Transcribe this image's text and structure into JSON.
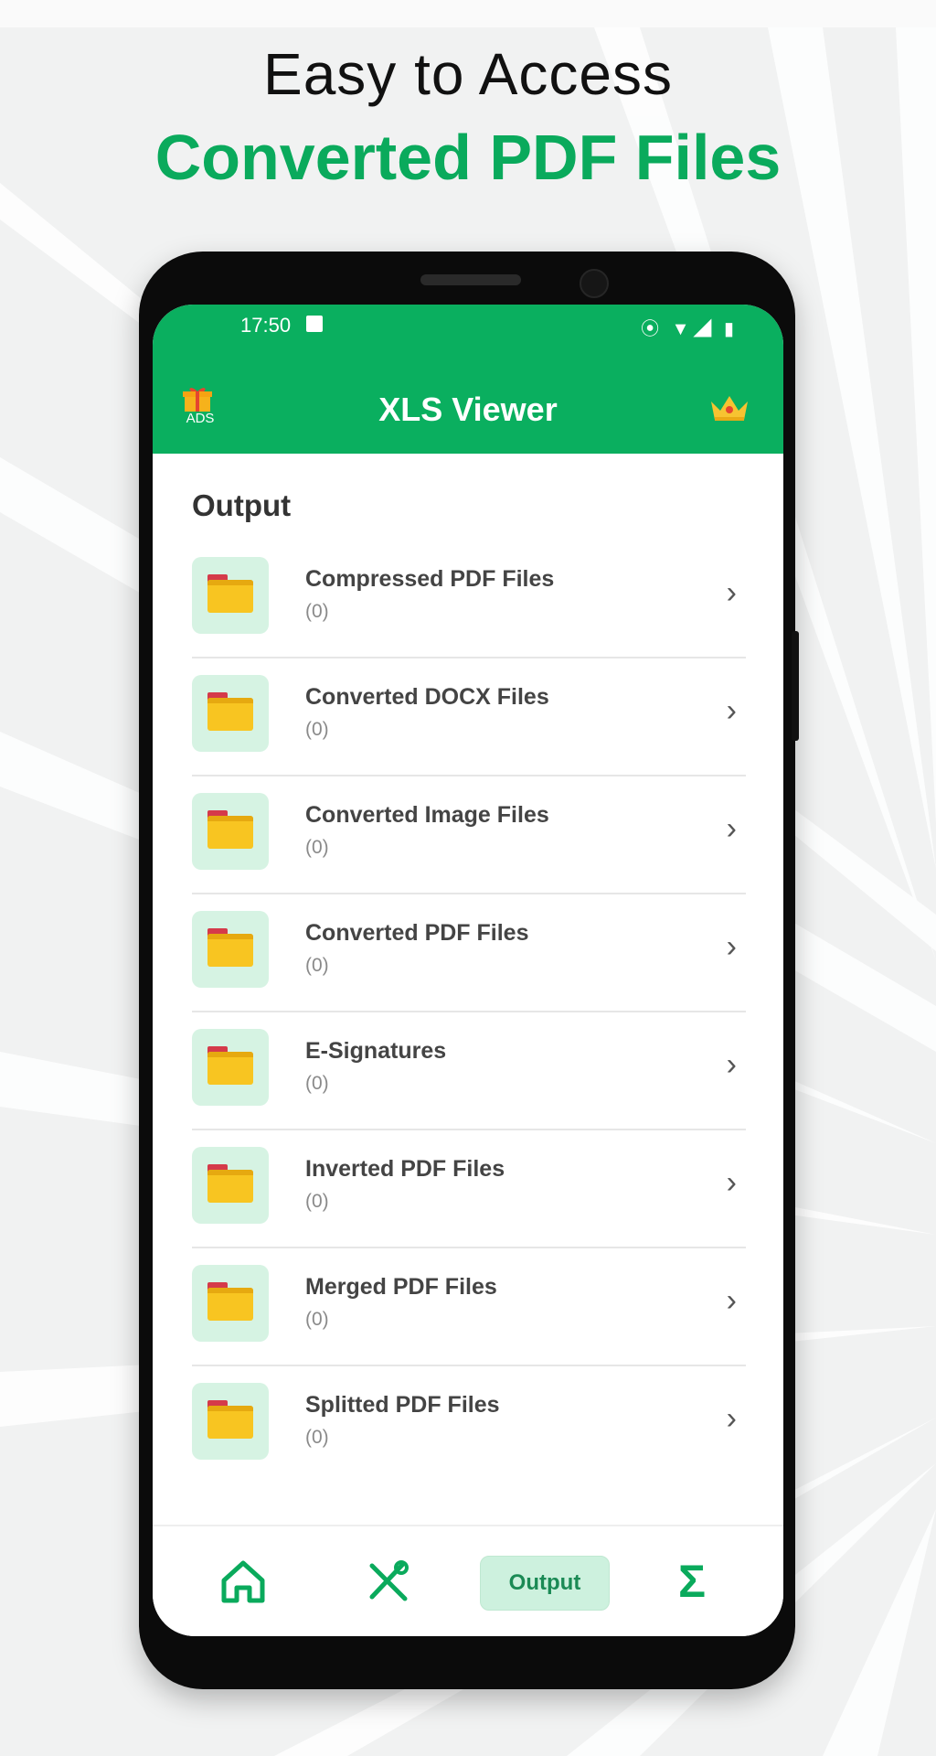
{
  "hero": {
    "line1": "Easy to Access",
    "line2": "Converted PDF Files"
  },
  "status_bar": {
    "time": "17:50",
    "icons": "⦿ ▼◢ ▮"
  },
  "app_bar": {
    "ads_label": "ADS",
    "title": "XLS Viewer"
  },
  "section_title": "Output",
  "items": [
    {
      "label": "Compressed PDF Files",
      "count": "(0)"
    },
    {
      "label": "Converted DOCX Files",
      "count": "(0)"
    },
    {
      "label": "Converted Image Files",
      "count": "(0)"
    },
    {
      "label": "Converted PDF Files",
      "count": "(0)"
    },
    {
      "label": "E-Signatures",
      "count": "(0)"
    },
    {
      "label": "Inverted PDF Files",
      "count": "(0)"
    },
    {
      "label": "Merged PDF Files",
      "count": "(0)"
    },
    {
      "label": "Splitted PDF Files",
      "count": "(0)"
    }
  ],
  "bottom_nav": {
    "output_label": "Output",
    "sigma_glyph": "Σ"
  },
  "colors": {
    "brand_green": "#0aaf5f",
    "folder_yellow": "#f8c521",
    "folder_tile": "#d6f3e3"
  }
}
